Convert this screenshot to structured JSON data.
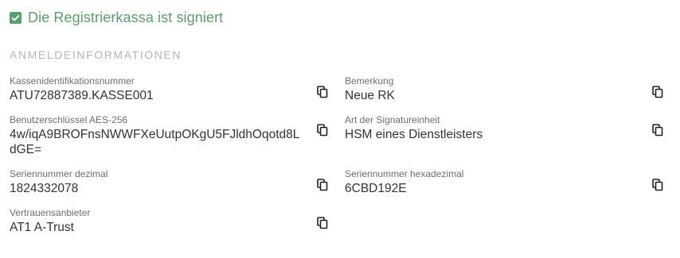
{
  "status": {
    "text": "Die Registrierkassa ist signiert",
    "icon": "checkbox-checked-icon",
    "color": "#5a9e6f"
  },
  "section_title": "ANMELDEINFORMATIONEN",
  "fields": {
    "kasse_id": {
      "label": "Kassenidentifikationsnummer",
      "value": "ATU72887389.KASSE001"
    },
    "aes_key": {
      "label": "Benutzerschlüssel AES-256",
      "value_line1": "4w/iqA9BROFnsNWWFXeUutpOKgU5FJldhOqotd8L",
      "value_line2": "dGE="
    },
    "serial_dec": {
      "label": "Seriennummer dezimal",
      "value": "1824332078"
    },
    "trust": {
      "label": "Vertrauensanbieter",
      "value": "AT1 A-Trust"
    },
    "remark": {
      "label": "Bemerkung",
      "value": "Neue RK"
    },
    "sig_type": {
      "label": "Art der Signatureinheit",
      "value": "HSM eines Dienstleisters"
    },
    "serial_hex": {
      "label": "Seriennummer hexadezimal",
      "value": "6CBD192E"
    }
  },
  "copy_icon": "copy-icon"
}
